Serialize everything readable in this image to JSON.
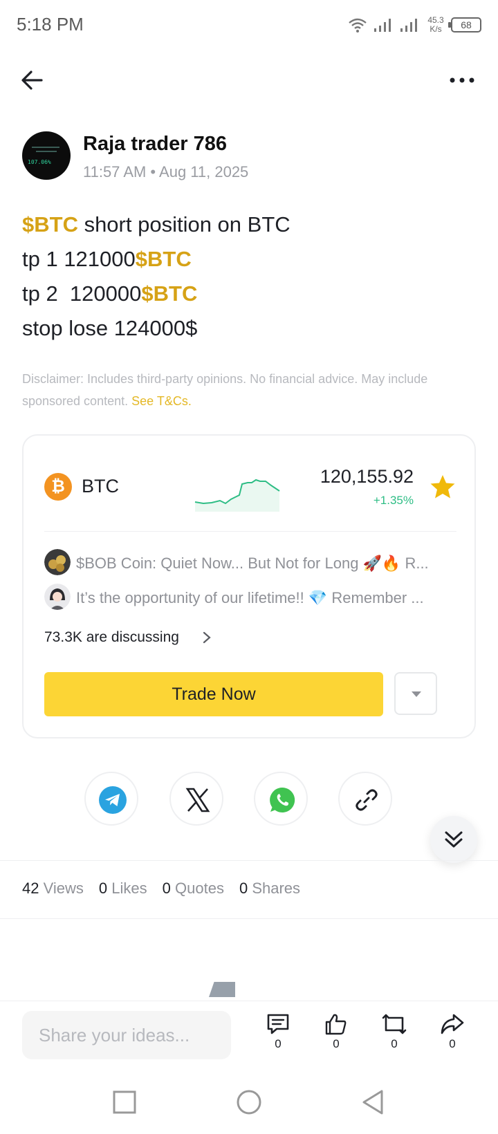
{
  "status_bar": {
    "time": "5:18 PM",
    "net_speed_value": "45.3",
    "net_speed_unit": "K/s",
    "battery": "68"
  },
  "post": {
    "author_name": "Raja trader 786",
    "avatar_text": "107.06%",
    "timestamp": "11:57 AM • Aug 11, 2025",
    "lines": [
      [
        {
          "text": "$BTC",
          "tag": true
        },
        {
          "text": " short position on BTC",
          "tag": false
        }
      ],
      [
        {
          "text": "tp 1 121000",
          "tag": false
        },
        {
          "text": "$BTC",
          "tag": true
        }
      ],
      [
        {
          "text": "tp 2  120000",
          "tag": false
        },
        {
          "text": "$BTC",
          "tag": true
        }
      ],
      [
        {
          "text": "stop lose 124000$",
          "tag": false
        }
      ]
    ],
    "disclaimer": "Disclaimer: Includes third-party opinions. No financial advice. May include sponsored content.",
    "disclaimer_link": "See T&Cs."
  },
  "coin_card": {
    "coin_icon": "₿",
    "coin": "BTC",
    "price": "120,155.92",
    "change": "+1.35%",
    "discussions": [
      "$BOB Coin: Quiet Now... But Not for Long 🚀🔥 R...",
      "It’s the opportunity of our lifetime!! 💎 Remember ..."
    ],
    "discuss_count": "73.3K are discussing",
    "trade_label": "Trade Now"
  },
  "share_targets": [
    "telegram-icon",
    "x-icon",
    "whatsapp-icon",
    "link-icon"
  ],
  "stats": [
    {
      "num": "42",
      "label": "Views"
    },
    {
      "num": "0",
      "label": "Likes"
    },
    {
      "num": "0",
      "label": "Quotes"
    },
    {
      "num": "0",
      "label": "Shares"
    }
  ],
  "bottom_bar": {
    "placeholder": "Share your ideas...",
    "comment_count": "0",
    "like_count": "0",
    "repost_count": "0",
    "share_count": "0"
  },
  "colors": {
    "accent_yellow": "#fcd535",
    "cashtag": "#d6a216",
    "positive": "#2ebd85",
    "btc_orange": "#f39321"
  }
}
